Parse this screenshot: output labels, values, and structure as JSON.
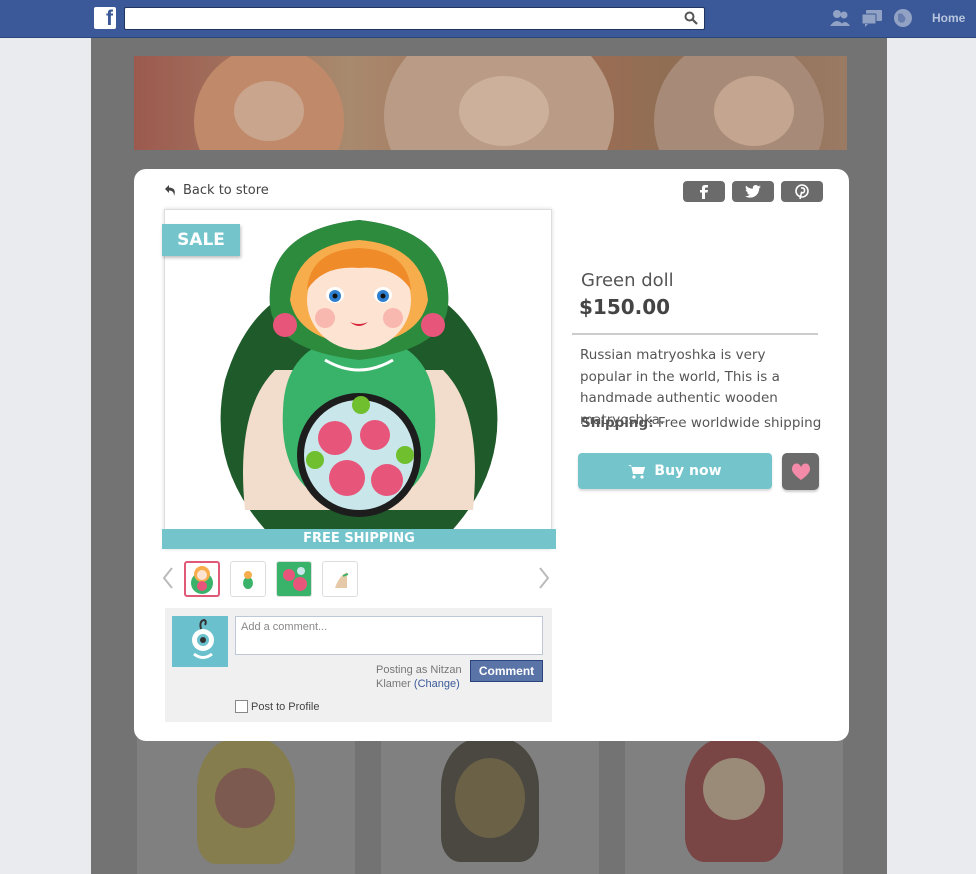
{
  "facebook_bar": {
    "logo_letter": "f",
    "search_value": "",
    "home_label": "Home",
    "icons": [
      "friends-icon",
      "messages-icon",
      "notifications-icon"
    ]
  },
  "modal": {
    "back_label": "Back to store",
    "share_buttons": [
      "facebook-icon",
      "twitter-icon",
      "pinterest-icon"
    ],
    "sale_badge": "SALE",
    "shipping_strip": "FREE SHIPPING",
    "product": {
      "title": "Green doll",
      "price": "$150.00",
      "description": "Russian matryoshka is very popular in the world,  This is a handmade authentic wooden matryoshka.",
      "shipping_label": "Shipping:",
      "shipping_value": " Free worldwide shipping",
      "buy_label": "Buy now"
    },
    "comments": {
      "placeholder": "Add a comment...",
      "posting_as": "Posting as Nitzan Klamer",
      "change_link": "(Change)",
      "comment_button": "Comment",
      "post_to_profile": "Post to Profile"
    }
  },
  "colors": {
    "facebook_blue": "#3b5998",
    "accent_teal": "#74c4cc",
    "dark_button": "#6b6b6b",
    "heart_pink": "#f28aa8"
  }
}
